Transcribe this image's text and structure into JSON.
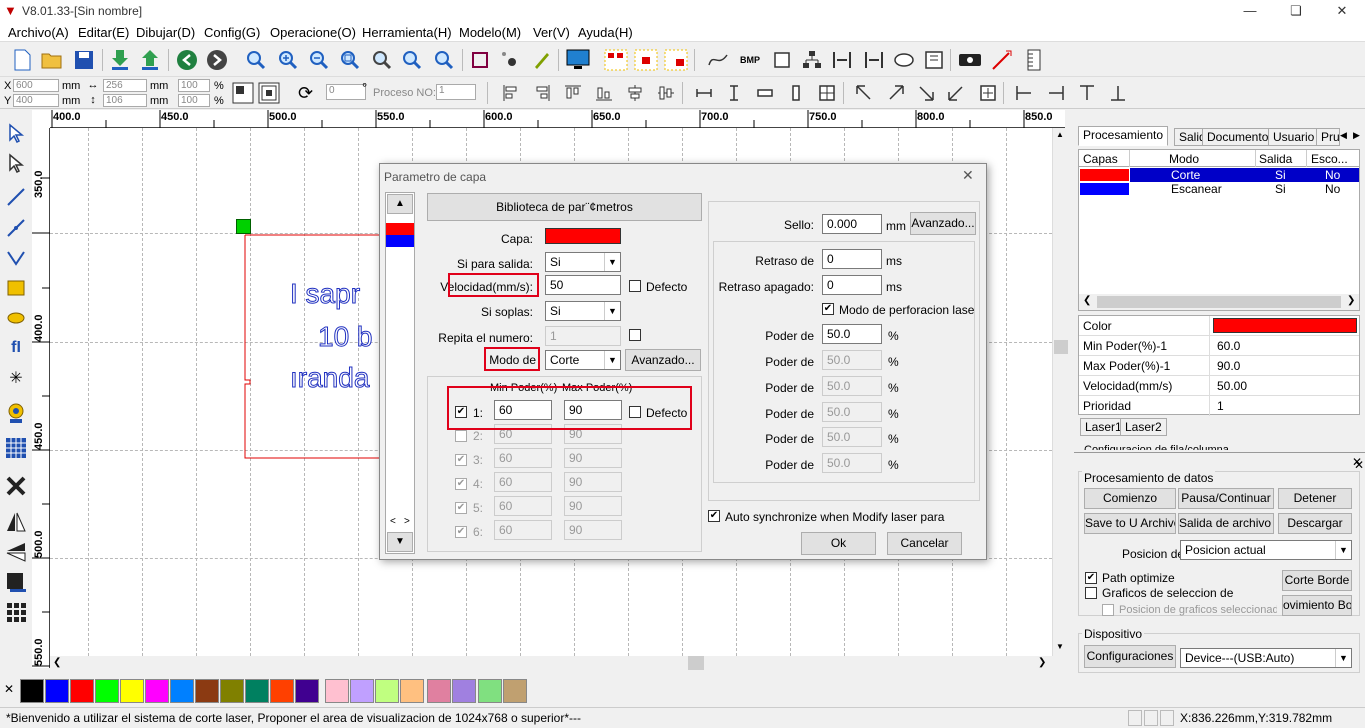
{
  "title_bar": {
    "title": "V8.01.33-[Sin nombre]"
  },
  "menu": [
    "Archivo(A)",
    "Editar(E)",
    "Dibujar(D)",
    "Config(G)",
    "Operacione(O)",
    "Herramienta(H)",
    "Modelo(M)",
    "Ver(V)",
    "Ayuda(H)"
  ],
  "toolbar2": {
    "x_label": "X",
    "y_label": "Y",
    "x_value": "600",
    "y_value": "400",
    "w_value": "256",
    "h_value": "106",
    "unit": "mm",
    "pct_x": "100",
    "pct_y": "100",
    "pct_unit": "%",
    "rotation_value": "0",
    "degree": "°",
    "proceso_label": "Proceso NO:",
    "proceso_value": "1"
  },
  "ruler": {
    "top": [
      "400.0",
      "450.0",
      "500.0",
      "550.0",
      "600.0",
      "650.0",
      "700.0",
      "750.0",
      "800.0",
      "850.0"
    ],
    "left": [
      "350.0",
      "400.0",
      "450.0",
      "500.0",
      "550.0"
    ]
  },
  "canvas_text": [
    "I sapr",
    "10 b",
    "ıranda"
  ],
  "dialog": {
    "title": "Parametro de capa",
    "library_button": "Biblioteca de par¨¢metros",
    "capa_label": "Capa:",
    "capa_color": "#ff0000",
    "salida_label": "Si para salida:",
    "salida_value": "Si",
    "velocidad_label": "Velocidad(mm/s):",
    "velocidad_value": "50",
    "defecto_label": "Defecto",
    "soplas_label": "Si soplas:",
    "soplas_value": "Si",
    "repita_label": "Repita el numero:",
    "repita_value": "1",
    "modo_label": "Modo de",
    "modo_value": "Corte",
    "avanzado_label": "Avanzado...",
    "min_header": "Min Poder(%)",
    "max_header": "Max Poder(%)",
    "power_rows": [
      {
        "n": "1:",
        "min": "60",
        "max": "90"
      },
      {
        "n": "2:",
        "min": "60",
        "max": "90"
      },
      {
        "n": "3:",
        "min": "60",
        "max": "90"
      },
      {
        "n": "4:",
        "min": "60",
        "max": "90"
      },
      {
        "n": "5:",
        "min": "60",
        "max": "90"
      },
      {
        "n": "6:",
        "min": "60",
        "max": "90"
      }
    ],
    "sello_label": "Sello:",
    "sello_value": "0.000",
    "mm": "mm",
    "ms": "ms",
    "pct": "%",
    "retraso_label": "Retraso de",
    "retraso_value": "0",
    "retraso_apagado_label": "Retraso apagado:",
    "retraso_apagado_value": "0",
    "perforacion_label": "Modo de perforacion lase",
    "poder_label": "Poder de",
    "poder_values": [
      "50.0",
      "50.0",
      "50.0",
      "50.0",
      "50.0",
      "50.0"
    ],
    "auto_sync_label": "Auto synchronize when Modify laser para",
    "ok_label": "Ok",
    "cancel_label": "Cancelar",
    "layer_colors": [
      "#ff0000",
      "#0000ff"
    ]
  },
  "right_panel": {
    "tabs": [
      "Procesamiento",
      "Salida",
      "Documento",
      "Usuario",
      "Pru"
    ],
    "layers_headers": [
      "Capas",
      "Modo",
      "Salida",
      "Esco..."
    ],
    "layers": [
      {
        "color": "#ff0000",
        "modo": "Corte",
        "salida": "Si",
        "esco": "No"
      },
      {
        "color": "#0000ff",
        "modo": "Escanear",
        "salida": "Si",
        "esco": "No"
      }
    ],
    "props": [
      {
        "label": "Color",
        "value": ""
      },
      {
        "label": "Min Poder(%)-1",
        "value": "60.0"
      },
      {
        "label": "Max Poder(%)-1",
        "value": "90.0"
      },
      {
        "label": "Velocidad(mm/s)",
        "value": "50.00"
      },
      {
        "label": "Prioridad",
        "value": "1"
      }
    ],
    "laser_tabs": [
      "Laser1",
      "Laser2"
    ],
    "config_cut": "Configuracion de fila/columna",
    "datos_title": "Procesamiento de datos",
    "buttons": [
      "Comienzo",
      "Pausa/Continuar",
      "Detener",
      "Save to U Archivo",
      "Salida de archivo U",
      "Descargar"
    ],
    "posicion_label": "Posicion de",
    "posicion_value": "Posicion actual",
    "path_optimize": "Path optimize",
    "graficos_label": "Graficos de seleccion de",
    "posicion_graficos": "Posicion de graficos seleccionado",
    "corte_borde": "Corte Borde",
    "movimiento_borde": "ovimiento Bord",
    "dispositivo_title": "Dispositivo",
    "configuraciones": "Configuraciones",
    "device_value": "Device---(USB:Auto)"
  },
  "palette": [
    "#000000",
    "#0000ff",
    "#ff0000",
    "#00ff00",
    "#ffff00",
    "#ff00ff",
    "#0080ff",
    "#8b3a12",
    "#808000",
    "#008060",
    "#ff4000",
    "#400090",
    "#ffc0d0",
    "#c0a0ff",
    "#c0ff80",
    "#ffc080",
    "#e080a0",
    "#a080e0",
    "#80e080",
    "#c0a070"
  ],
  "status": {
    "message": "*Bienvenido a utilizar el sistema de corte laser, Proponer el area de visualizacion de 1024x768 o superior*---",
    "coords": "X:836.226mm,Y:319.782mm"
  }
}
